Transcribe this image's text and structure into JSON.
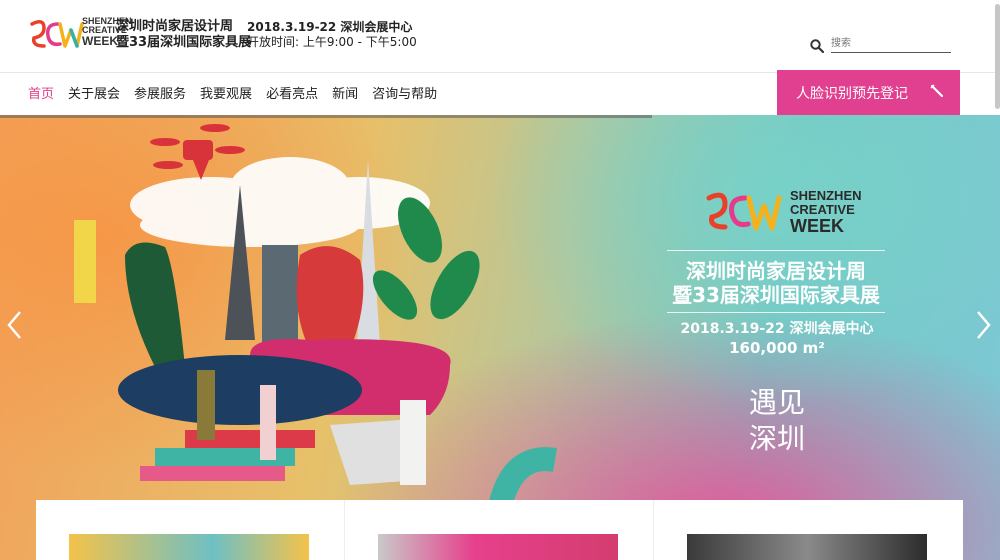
{
  "header": {
    "logo_text": "SCW",
    "logo_sub": [
      "SHENZHEN",
      "CREATIVE",
      "WEEK"
    ],
    "event_name_line1": "深圳时尚家居设计周",
    "event_name_line2": "暨33届深圳国际家具展",
    "event_date_line": "2018.3.19-22  深圳会展中心",
    "event_hours_line": "开放时间: 上午9:00 - 下午5:00",
    "search": {
      "placeholder": "搜索",
      "icon": "search-icon"
    }
  },
  "nav": {
    "items": [
      {
        "label": "首页",
        "active": true
      },
      {
        "label": "关于展会",
        "active": false
      },
      {
        "label": "参展服务",
        "active": false
      },
      {
        "label": "我要观展",
        "active": false
      },
      {
        "label": "必看亮点",
        "active": false
      },
      {
        "label": "新闻",
        "active": false
      },
      {
        "label": "咨询与帮助",
        "active": false
      }
    ],
    "cta_label": "人脸识别预先登记",
    "cta_icon": "pencil-icon"
  },
  "hero": {
    "logo_sub": [
      "SHENZHEN",
      "CREATIVE",
      "WEEK"
    ],
    "title_line1": "深圳时尚家居设计周",
    "title_line2": "暨33届深圳国际家具展",
    "date_line": "2018.3.19-22  深圳会展中心",
    "area_line": "160,000 m²",
    "slogan_line1": "遇见",
    "slogan_line2": "深圳",
    "prev_icon": "chevron-left-icon",
    "next_icon": "chevron-right-icon"
  },
  "colors": {
    "accent": "#e0408f",
    "nav_active": "#e23c8a",
    "header_bg": "#ffffff",
    "logo_red": "#e8402a",
    "logo_yellow": "#f3b21b",
    "logo_teal": "#2fb3a9",
    "logo_pink": "#e23c8a"
  }
}
